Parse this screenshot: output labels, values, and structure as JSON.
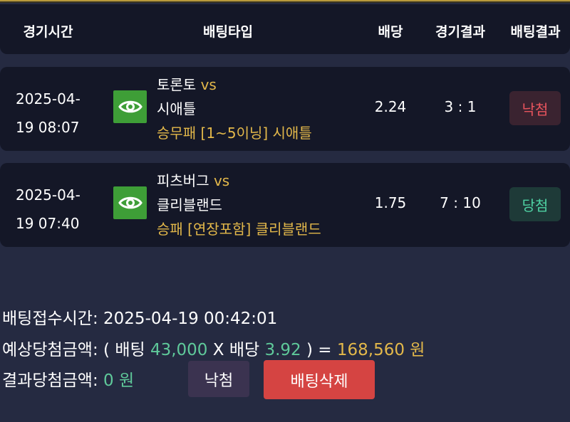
{
  "header": {
    "col_time": "경기시간",
    "col_type": "배팅타입",
    "col_odds": "배당",
    "col_result": "경기결과",
    "col_bet_result": "배팅결과"
  },
  "rows": [
    {
      "time_date": "2025-04-",
      "time_clock": "19 08:07",
      "home": "토론토",
      "vs": "vs",
      "away": "시애틀",
      "pick": "승무패 [1~5이닝] 시애틀",
      "odds": "2.24",
      "score": "3 : 1",
      "result": "낙첨",
      "result_status": "lose"
    },
    {
      "time_date": "2025-04-",
      "time_clock": "19 07:40",
      "home": "피츠버그",
      "vs": "vs",
      "away": "클리블랜드",
      "pick": "승패 [연장포함] 클리블랜드",
      "odds": "1.75",
      "score": "7 : 10",
      "result": "당첨",
      "result_status": "win"
    }
  ],
  "summary": {
    "received_label": "배팅접수시간:",
    "received_value": "2025-04-19 00:42:01",
    "expected_label": "예상당첨금액:",
    "expected_open": "( 배팅",
    "bet_amount": "43,000",
    "times": "X 배당",
    "total_odds": "3.92",
    "close_eq": ") =",
    "expected_amount": "168,560 원",
    "actual_label": "결과당첨금액:",
    "actual_amount": "0 원"
  },
  "buttons": {
    "status_label": "낙첨",
    "delete_label": "배팅삭제"
  },
  "colors": {
    "background": "#252a41",
    "panel": "#141727",
    "gold": "#e3b84a",
    "green": "#5fc99a",
    "lose": "#e8545d",
    "win": "#4fd1a3",
    "delete": "#d54442"
  },
  "icons": {
    "view": "eye-icon"
  }
}
